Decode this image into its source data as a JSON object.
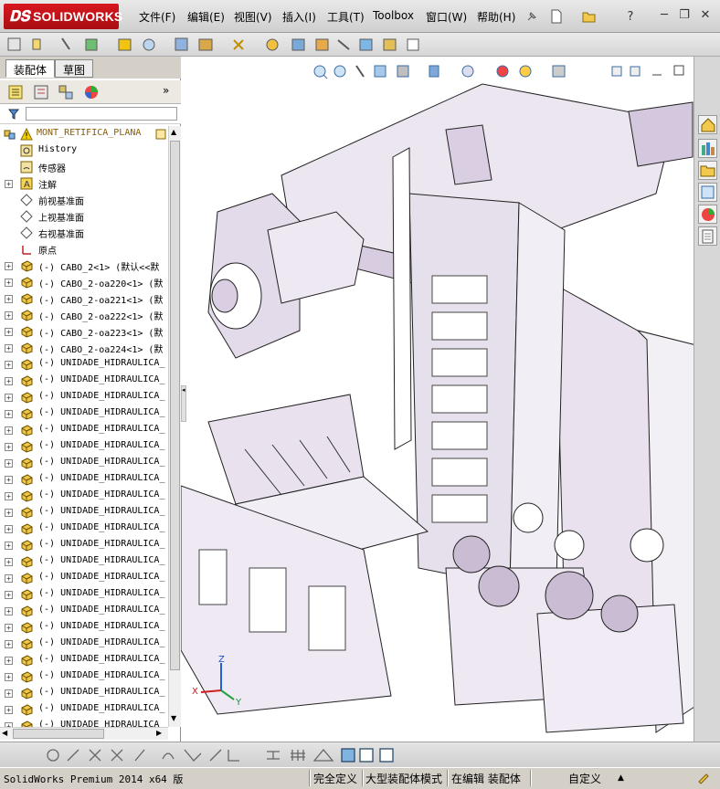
{
  "app": {
    "logo_ds": "𝐃𝐒",
    "logo_text": "SOLIDWORKS"
  },
  "menu": [
    "文件(F)",
    "编辑(E)",
    "视图(V)",
    "插入(I)",
    "工具(T)",
    "Toolbox",
    "窗口(W)",
    "帮助(H)"
  ],
  "window_controls": {
    "minimize": "─",
    "restore": "❐",
    "close": "✕"
  },
  "tabs": [
    "装配体",
    "草图"
  ],
  "tree": {
    "root": "MONT_RETIFICA_PLANA",
    "items": [
      {
        "label": "History",
        "icon": "history-icon",
        "expandable": false
      },
      {
        "label": "传感器",
        "icon": "sensor-icon",
        "expandable": false
      },
      {
        "label": "注解",
        "icon": "annotation-icon",
        "expandable": true
      },
      {
        "label": "前视基准面",
        "icon": "plane-icon",
        "expandable": false
      },
      {
        "label": "上视基准面",
        "icon": "plane-icon",
        "expandable": false
      },
      {
        "label": "右视基准面",
        "icon": "plane-icon",
        "expandable": false
      },
      {
        "label": "原点",
        "icon": "origin-icon",
        "expandable": false
      },
      {
        "label": "(-) CABO_2<1> (默认<<默",
        "icon": "part-icon",
        "expandable": true
      },
      {
        "label": "(-) CABO_2-oa220<1> (默",
        "icon": "part-icon",
        "expandable": true
      },
      {
        "label": "(-) CABO_2-oa221<1> (默",
        "icon": "part-icon",
        "expandable": true
      },
      {
        "label": "(-) CABO_2-oa222<1> (默",
        "icon": "part-icon",
        "expandable": true
      },
      {
        "label": "(-) CABO_2-oa223<1> (默",
        "icon": "part-icon",
        "expandable": true
      },
      {
        "label": "(-) CABO_2-oa224<1> (默",
        "icon": "part-icon",
        "expandable": true
      },
      {
        "label": "(-) UNIDADE_HIDRAULICA_",
        "icon": "part-icon",
        "expandable": true
      },
      {
        "label": "(-) UNIDADE_HIDRAULICA_",
        "icon": "part-icon",
        "expandable": true
      },
      {
        "label": "(-) UNIDADE_HIDRAULICA_",
        "icon": "part-icon",
        "expandable": true
      },
      {
        "label": "(-) UNIDADE_HIDRAULICA_",
        "icon": "part-icon",
        "expandable": true
      },
      {
        "label": "(-) UNIDADE_HIDRAULICA_",
        "icon": "part-icon",
        "expandable": true
      },
      {
        "label": "(-) UNIDADE_HIDRAULICA_",
        "icon": "part-icon",
        "expandable": true
      },
      {
        "label": "(-) UNIDADE_HIDRAULICA_",
        "icon": "part-icon",
        "expandable": true
      },
      {
        "label": "(-) UNIDADE_HIDRAULICA_",
        "icon": "part-icon",
        "expandable": true
      },
      {
        "label": "(-) UNIDADE_HIDRAULICA_",
        "icon": "part-icon",
        "expandable": true
      },
      {
        "label": "(-) UNIDADE_HIDRAULICA_",
        "icon": "part-icon",
        "expandable": true
      },
      {
        "label": "(-) UNIDADE_HIDRAULICA_",
        "icon": "part-icon",
        "expandable": true
      },
      {
        "label": "(-) UNIDADE_HIDRAULICA_",
        "icon": "part-icon",
        "expandable": true
      },
      {
        "label": "(-) UNIDADE_HIDRAULICA_",
        "icon": "part-icon",
        "expandable": true
      },
      {
        "label": "(-) UNIDADE_HIDRAULICA_",
        "icon": "part-icon",
        "expandable": true
      },
      {
        "label": "(-) UNIDADE_HIDRAULICA_",
        "icon": "part-icon",
        "expandable": true
      },
      {
        "label": "(-) UNIDADE_HIDRAULICA_",
        "icon": "part-icon",
        "expandable": true
      },
      {
        "label": "(-) UNIDADE_HIDRAULICA_",
        "icon": "part-icon",
        "expandable": true
      },
      {
        "label": "(-) UNIDADE_HIDRAULICA_",
        "icon": "part-icon",
        "expandable": true
      },
      {
        "label": "(-) UNIDADE_HIDRAULICA_",
        "icon": "part-icon",
        "expandable": true
      },
      {
        "label": "(-) UNIDADE_HIDRAULICA_",
        "icon": "part-icon",
        "expandable": true
      },
      {
        "label": "(-) UNIDADE_HIDRAULICA_",
        "icon": "part-icon",
        "expandable": true
      },
      {
        "label": "(-) UNIDADE_HIDRAULICA_",
        "icon": "part-icon",
        "expandable": true
      },
      {
        "label": "(-) UNIDADE_HIDRAULICA_",
        "icon": "part-icon",
        "expandable": true
      },
      {
        "label": "(-) UNIDADE_HIDRAULICA_",
        "icon": "part-icon",
        "expandable": true
      }
    ]
  },
  "triad": {
    "x": "X",
    "y": "Y",
    "z": "Z"
  },
  "status": {
    "product": "SolidWorks Premium 2014 x64 版",
    "definition": "完全定义",
    "mode": "大型装配体模式",
    "editing": "在编辑 装配体",
    "units": "自定义"
  },
  "colors": {
    "model_fill": "#ddd2e3",
    "model_edge": "#2a2a2a",
    "brand_red": "#c4121a"
  }
}
